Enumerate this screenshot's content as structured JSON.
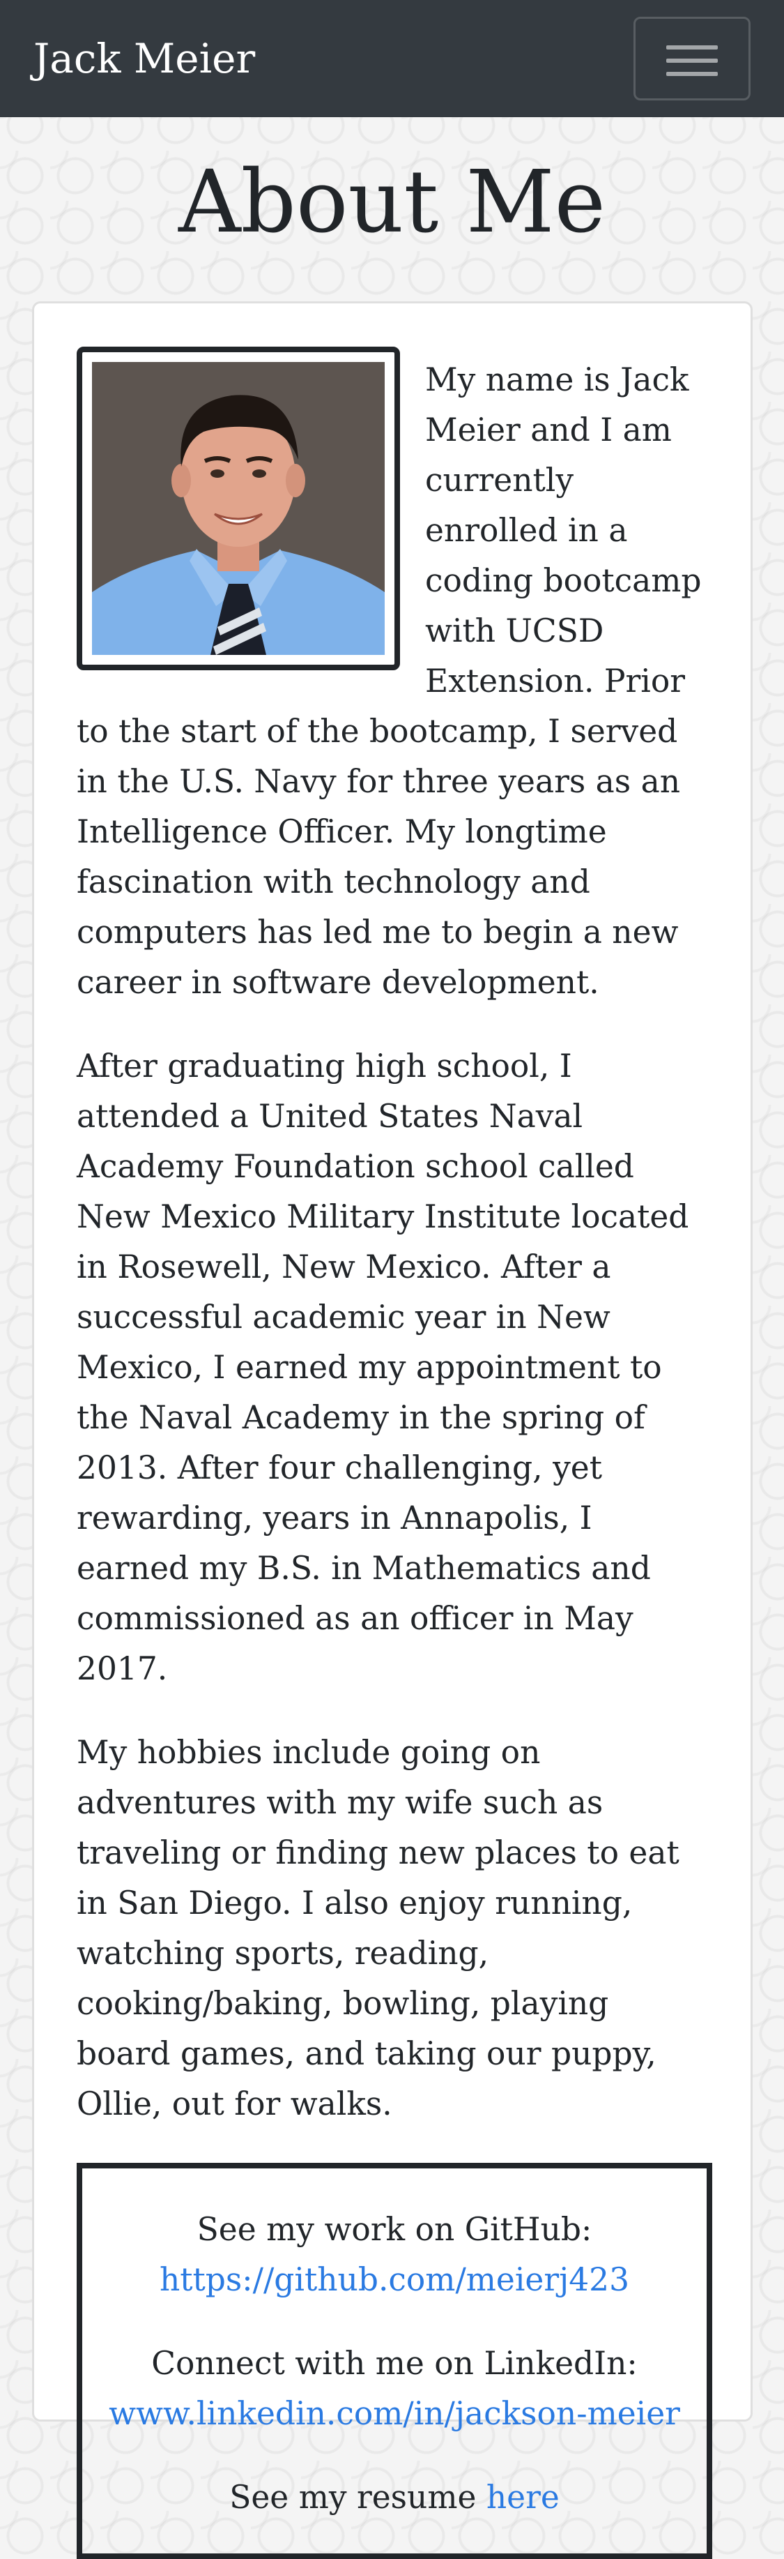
{
  "navbar": {
    "brand": "Jack Meier",
    "toggle_icon": "hamburger-menu-icon"
  },
  "page": {
    "title": "About Me"
  },
  "about": {
    "photo_icon": "profile-photo",
    "paragraphs": [
      "My name is Jack Meier and I am currently enrolled in a coding bootcamp with UCSD Extension. Prior to the start of the bootcamp, I served in the U.S. Navy for three years as an Intelligence Officer. My longtime fascination with technology and computers has led me to begin a new career in software development.",
      "After graduating high school, I attended a United States Naval Academy Foundation school called New Mexico Military Institute located in Rosewell, New Mexico. After a successful academic year in New Mexico, I earned my appointment to the Naval Academy in the spring of 2013. After four challenging, yet rewarding, years in Annapolis, I earned my B.S. in Mathematics and commissioned as an officer in May 2017.",
      "My hobbies include going on adventures with my wife such as traveling or finding new places to eat in San Diego. I also enjoy running, watching sports, reading, cooking/baking, bowling, playing board games, and taking our puppy, Ollie, out for walks."
    ]
  },
  "links": {
    "github_label": "See my work on GitHub:",
    "github_url": "https://github.com/meierj423",
    "linkedin_label": "Connect with me on LinkedIn:",
    "linkedin_url": "www.linkedin.com/in/jackson-meier",
    "resume_label": "See my resume",
    "resume_link": "here"
  },
  "colors": {
    "navbar_bg": "#343a40",
    "link": "#2a7ae2",
    "border": "#212529"
  }
}
